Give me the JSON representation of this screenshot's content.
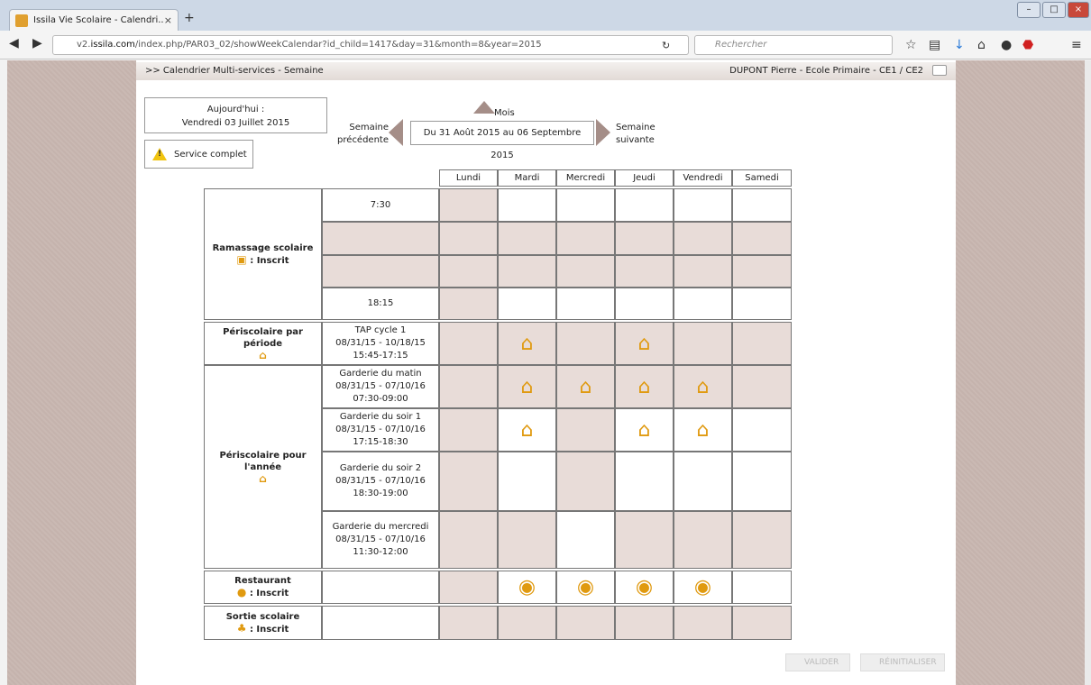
{
  "browser": {
    "tab_title": "Issila Vie Scolaire - Calendri...",
    "tab_close": "×",
    "new_tab": "+",
    "url_prefix": "v2.",
    "url_domain": "issila.com",
    "url_path": "/index.php/PAR03_02/showWeekCalendar?id_child=1417&day=31&month=8&year=2015",
    "search_placeholder": "Rechercher"
  },
  "header": {
    "breadcrumb": ">> Calendrier Multi-services - Semaine",
    "user": "DUPONT Pierre - Ecole Primaire - CE1 / CE2"
  },
  "today": {
    "label": "Aujourd'hui :",
    "date": "Vendredi 03 Juillet 2015"
  },
  "legend": {
    "complet": "Service complet"
  },
  "nav": {
    "prev_line1": "Semaine",
    "prev_line2": "précédente",
    "next_line1": "Semaine",
    "next_line2": "suivante",
    "month": "Mois",
    "week_range": "Du 31 Août 2015 au 06 Septembre 2015"
  },
  "days": [
    "Lundi",
    "Mardi",
    "Mercredi",
    "Jeudi",
    "Vendredi",
    "Samedi"
  ],
  "services": {
    "ramassage": {
      "label": "Ramassage scolaire",
      "status": ": Inscrit",
      "times": [
        "7:30",
        "",
        "",
        "18:15"
      ]
    },
    "peri_periode": {
      "label": "Périscolaire par période",
      "rows": [
        {
          "name": "TAP cycle 1",
          "dates": "08/31/15 - 10/18/15",
          "hours": "15:45-17:15"
        }
      ]
    },
    "peri_annee": {
      "label": "Périscolaire pour l'année",
      "rows": [
        {
          "name": "Garderie du matin",
          "dates": "08/31/15 - 07/10/16",
          "hours": "07:30-09:00"
        },
        {
          "name": "Garderie du soir 1",
          "dates": "08/31/15 - 07/10/16",
          "hours": "17:15-18:30"
        },
        {
          "name": "Garderie du soir 2",
          "dates": "08/31/15 - 07/10/16",
          "hours": "18:30-19:00"
        },
        {
          "name": "Garderie du mercredi",
          "dates": "08/31/15 - 07/10/16",
          "hours": "11:30-12:00"
        }
      ]
    },
    "restaurant": {
      "label": "Restaurant",
      "status": ": Inscrit"
    },
    "sortie": {
      "label": "Sortie scolaire",
      "status": ": Inscrit"
    }
  },
  "buttons": {
    "valider": "VALIDER",
    "reinit": "RÉINITIALISER"
  },
  "colors": {
    "shaded": "#e8dcd8",
    "accent": "#e09a10",
    "arrow": "#a58e88"
  }
}
